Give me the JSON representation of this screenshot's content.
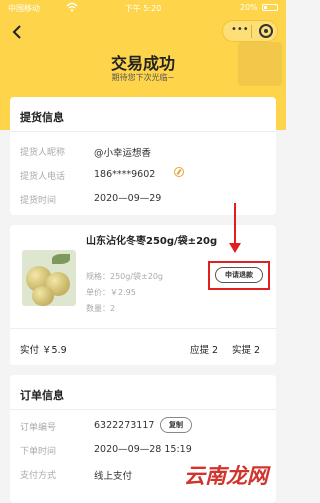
{
  "status_bar": {
    "carrier": "中国移动",
    "time": "下午 5:20",
    "battery": "20%"
  },
  "header": {
    "title": "交易成功",
    "subtitle": "期待您下次光临~"
  },
  "pickup": {
    "heading": "提货信息",
    "rows": [
      {
        "label": "提货人昵称",
        "value": "@小幸运想香"
      },
      {
        "label": "提货人电话",
        "value": "186****9602"
      },
      {
        "label": "提货时间",
        "value": "2020—09—29"
      }
    ]
  },
  "product": {
    "title": "山东沾化冬枣250g/袋±20g",
    "spec": "规格：250g/袋±20g",
    "price": "单价：￥2.95",
    "qty": "数量：2",
    "refund_label": "申请退款",
    "paid": "实付 ￥5.9",
    "due": "应提 2",
    "received": "实提 2"
  },
  "order": {
    "heading": "订单信息",
    "rows": [
      {
        "label": "订单编号",
        "value": "6322273117"
      },
      {
        "label": "下单时间",
        "value": "2020—09—28 15:19"
      },
      {
        "label": "支付方式",
        "value": "线上支付"
      }
    ],
    "copy_label": "复制"
  },
  "watermark": "云南龙网",
  "colors": {
    "hero": "#fdd44a",
    "highlight": "#e02020"
  }
}
